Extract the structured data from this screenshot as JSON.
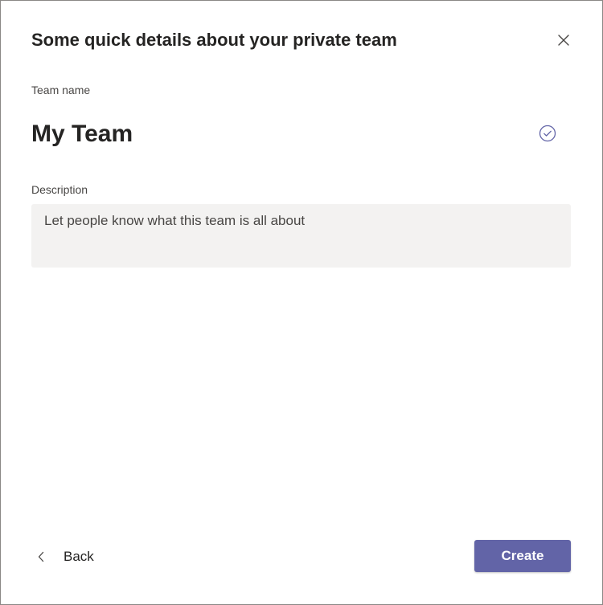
{
  "dialog": {
    "title": "Some quick details about your private team",
    "close_icon": "close-icon"
  },
  "team_name": {
    "label": "Team name",
    "value": "My Team",
    "status_icon": "check-circle-icon"
  },
  "description": {
    "label": "Description",
    "placeholder": "Let people know what this team is all about",
    "value": ""
  },
  "footer": {
    "back_label": "Back",
    "back_icon": "chevron-left-icon",
    "create_label": "Create"
  },
  "colors": {
    "accent": "#6264a7",
    "input_background": "#f3f2f1",
    "text": "#252423"
  }
}
